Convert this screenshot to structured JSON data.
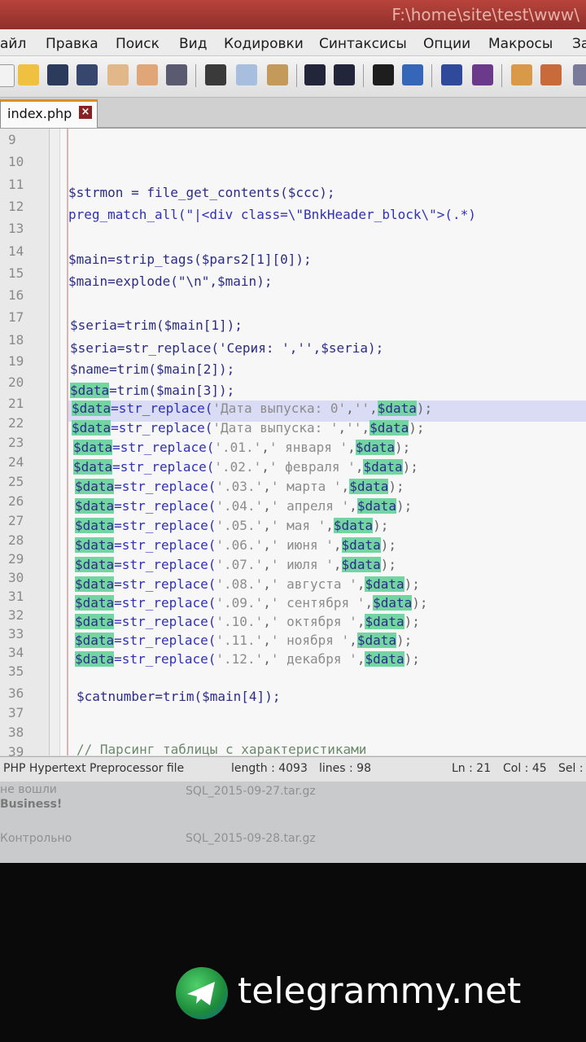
{
  "window": {
    "title": "F:\\home\\site\\test\\www\\"
  },
  "menu": [
    "айл",
    "Правка",
    "Поиск",
    "Вид",
    "Кодировки",
    "Синтаксисы",
    "Опции",
    "Макросы",
    "За"
  ],
  "tab": {
    "label": "index.php"
  },
  "editor": {
    "line_numbers": [
      "9",
      "10",
      "11",
      "12",
      "13",
      "14",
      "15",
      "16",
      "17",
      "18",
      "19",
      "20",
      "21",
      "22",
      "23",
      "24",
      "25",
      "26",
      "27",
      "28",
      "29",
      "30",
      "31",
      "32",
      "33",
      "34",
      "35",
      "36",
      "37",
      "38",
      "39"
    ],
    "lines": {
      "l11": "$strmon = file_get_contents($ccc);",
      "l12": "preg_match_all(\"|<div class=\\\"BnkHeader_block\\\">(.*)",
      "l14": "$main=strip_tags($pars2[1][0]);",
      "l15": "$main=explode(\"\\n\",$main);",
      "l17": "$seria=trim($main[1]);",
      "l18": "$seria=str_replace('Серия: ','',$seria);",
      "l19": "$name=trim($main[2]);",
      "l20a": "$data",
      "l20b": "=trim($main[3]);",
      "l36": "$catnumber=trim($main[4]);",
      "l39": "// Парсинг таблицы с характеристиками"
    },
    "data_var": "$data",
    "replace_fn": "=str_replace(",
    "replace_rows": [
      {
        "a": "'Дата выпуска: 0'",
        "b": "''"
      },
      {
        "a": "'Дата выпуска: '",
        "b": "''"
      },
      {
        "a": "'.01.'",
        "b": "' января '"
      },
      {
        "a": "'.02.'",
        "b": "' февраля '"
      },
      {
        "a": "'.03.'",
        "b": "' марта '"
      },
      {
        "a": "'.04.'",
        "b": "' апреля '"
      },
      {
        "a": "'.05.'",
        "b": "' мая '"
      },
      {
        "a": "'.06.'",
        "b": "' июня '"
      },
      {
        "a": "'.07.'",
        "b": "' июля '"
      },
      {
        "a": "'.08.'",
        "b": "' августа '"
      },
      {
        "a": "'.09.'",
        "b": "' сентября '"
      },
      {
        "a": "'.10.'",
        "b": "' октября '"
      },
      {
        "a": "'.11.'",
        "b": "' ноября '"
      },
      {
        "a": "'.12.'",
        "b": "' декабря '"
      }
    ]
  },
  "status": {
    "filetype": "PHP Hypertext Preprocessor file",
    "length": "length : 4093",
    "lines": "lines : 98",
    "ln": "Ln : 21",
    "col": "Col : 45",
    "sel": "Sel :"
  },
  "background_window": {
    "left1": "не вошли",
    "left2": "Business!",
    "left3": "Контрольно",
    "file1": "SQL_2015-09-27.tar.gz",
    "file2": "SQL_2015-09-28.tar.gz"
  },
  "watermark": {
    "text": "telegrammy.net"
  },
  "colors": {
    "titlebar": "#a33a33",
    "highlight": "#73d6a2",
    "current_line": "#d9dcf4"
  }
}
